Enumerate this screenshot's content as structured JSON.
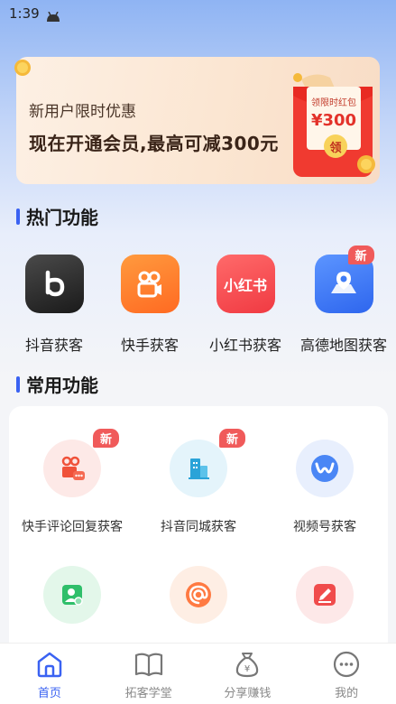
{
  "status_bar": {
    "time": "1:39"
  },
  "banner": {
    "subtitle": "新用户限时优惠",
    "headline": "现在开通会员,最高可减300元",
    "envelope_title": "领限时红包",
    "envelope_amount": "¥300",
    "envelope_button": "领"
  },
  "hot_section": {
    "title": "热门功能",
    "items": [
      {
        "label": "抖音获客",
        "icon": "douyin-icon",
        "badge": ""
      },
      {
        "label": "快手获客",
        "icon": "kuaishou-icon",
        "badge": ""
      },
      {
        "label": "小红书获客",
        "icon": "xiaohongshu-icon",
        "icon_text": "小红书",
        "badge": ""
      },
      {
        "label": "高德地图获客",
        "icon": "amap-icon",
        "badge": "新"
      }
    ]
  },
  "common_section": {
    "title": "常用功能",
    "items": [
      {
        "label": "快手评论回复获客",
        "icon": "kuaishou-comment-icon",
        "badge": "新"
      },
      {
        "label": "抖音同城获客",
        "icon": "city-building-icon",
        "badge": "新"
      },
      {
        "label": "视频号获客",
        "icon": "wechat-channels-icon",
        "badge": ""
      }
    ]
  },
  "tabbar": {
    "tabs": [
      {
        "label": "首页",
        "icon": "home-icon",
        "active": true
      },
      {
        "label": "拓客学堂",
        "icon": "book-icon",
        "active": false
      },
      {
        "label": "分享赚钱",
        "icon": "money-bag-icon",
        "active": false
      },
      {
        "label": "我的",
        "icon": "profile-icon",
        "active": false
      }
    ]
  },
  "colors": {
    "accent": "#3a62f2",
    "badge": "#f05a5a",
    "douyin": "#222222",
    "kuaishou": "#ff7a2e",
    "xiaohongshu": "#f5474d",
    "amap": "#3f7cf5"
  }
}
